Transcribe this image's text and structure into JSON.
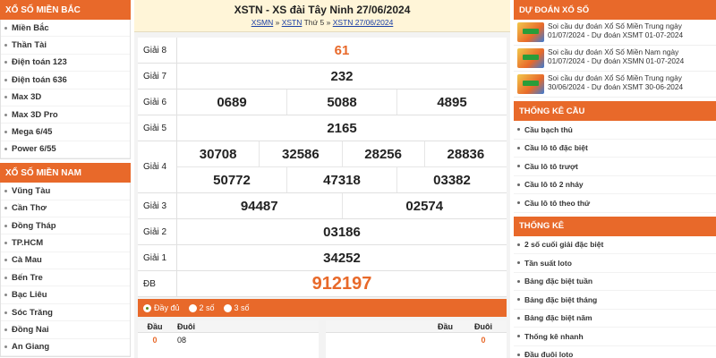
{
  "left": {
    "north": {
      "title": "XỔ SỐ MIỀN BẮC",
      "items": [
        "Miền Bắc",
        "Thần Tài",
        "Điện toán 123",
        "Điện toán 636",
        "Max 3D",
        "Max 3D Pro",
        "Mega 6/45",
        "Power 6/55"
      ]
    },
    "south": {
      "title": "XỔ SỐ MIỀN NAM",
      "items": [
        "Vũng Tàu",
        "Cần Thơ",
        "Đồng Tháp",
        "TP.HCM",
        "Cà Mau",
        "Bến Tre",
        "Bạc Liêu",
        "Sóc Trăng",
        "Đồng Nai",
        "An Giang"
      ]
    }
  },
  "center": {
    "title": "XSTN - XS đài Tây Ninh 27/06/2024",
    "breadcrumb": {
      "a": "XSMN",
      "sep1": " » ",
      "b": "XSTN",
      "mid": " Thứ 5 » ",
      "c": "XSTN 27/06/2024"
    },
    "prizes": [
      {
        "label": "Giải 8",
        "rows": [
          [
            "61"
          ]
        ],
        "style": "red"
      },
      {
        "label": "Giải 7",
        "rows": [
          [
            "232"
          ]
        ]
      },
      {
        "label": "Giải 6",
        "rows": [
          [
            "0689",
            "5088",
            "4895"
          ]
        ]
      },
      {
        "label": "Giải 5",
        "rows": [
          [
            "2165"
          ]
        ]
      },
      {
        "label": "Giải 4",
        "rows": [
          [
            "30708",
            "32586",
            "28256",
            "28836"
          ],
          [
            "50772",
            "47318",
            "03382"
          ]
        ]
      },
      {
        "label": "Giải 3",
        "rows": [
          [
            "94487",
            "02574"
          ]
        ]
      },
      {
        "label": "Giải 2",
        "rows": [
          [
            "03186"
          ]
        ]
      },
      {
        "label": "Giải 1",
        "rows": [
          [
            "34252"
          ]
        ]
      },
      {
        "label": "ĐB",
        "rows": [
          [
            "912197"
          ]
        ],
        "style": "red big"
      }
    ],
    "options": [
      "Đầy đủ",
      "2 số",
      "3 số"
    ],
    "options_selected": 0,
    "head_table": {
      "col_dau": "Đầu",
      "col_duoi": "Đuôi",
      "row_dau": "0",
      "row_duoi": "08"
    },
    "tail_table": {
      "col_dau": "Đầu",
      "col_duoi": "Đuôi",
      "row_duoi": "0"
    }
  },
  "right": {
    "predict": {
      "title": "DỰ ĐOÁN XỔ SỐ",
      "items": [
        "Soi cầu dự đoán Xổ Số Miền Trung ngày 01/07/2024 - Dự đoán XSMT 01-07-2024",
        "Soi cầu dự đoán Xổ Số Miền Nam ngày 01/07/2024 - Dự đoán XSMN 01-07-2024",
        "Soi cầu dự đoán Xổ Số Miền Trung ngày 30/06/2024 - Dự đoán XSMT 30-06-2024"
      ]
    },
    "cau": {
      "title": "THỐNG KÊ CẦU",
      "items": [
        "Cầu bạch thủ",
        "Cầu lô tô đặc biệt",
        "Cầu lô tô trượt",
        "Cầu lô tô 2 nháy",
        "Cầu lô tô theo thứ"
      ]
    },
    "stats": {
      "title": "THỐNG KÊ",
      "items": [
        "2 số cuối giải đặc biệt",
        "Tần suất loto",
        "Bảng đặc biệt tuần",
        "Bảng đặc biệt tháng",
        "Bảng đặc biệt năm",
        "Thống kê nhanh",
        "Đầu đuôi loto"
      ]
    }
  },
  "colors": {
    "accent": "#e8692a",
    "link": "#1a3fa6",
    "title_bg": "#fff5d8"
  }
}
